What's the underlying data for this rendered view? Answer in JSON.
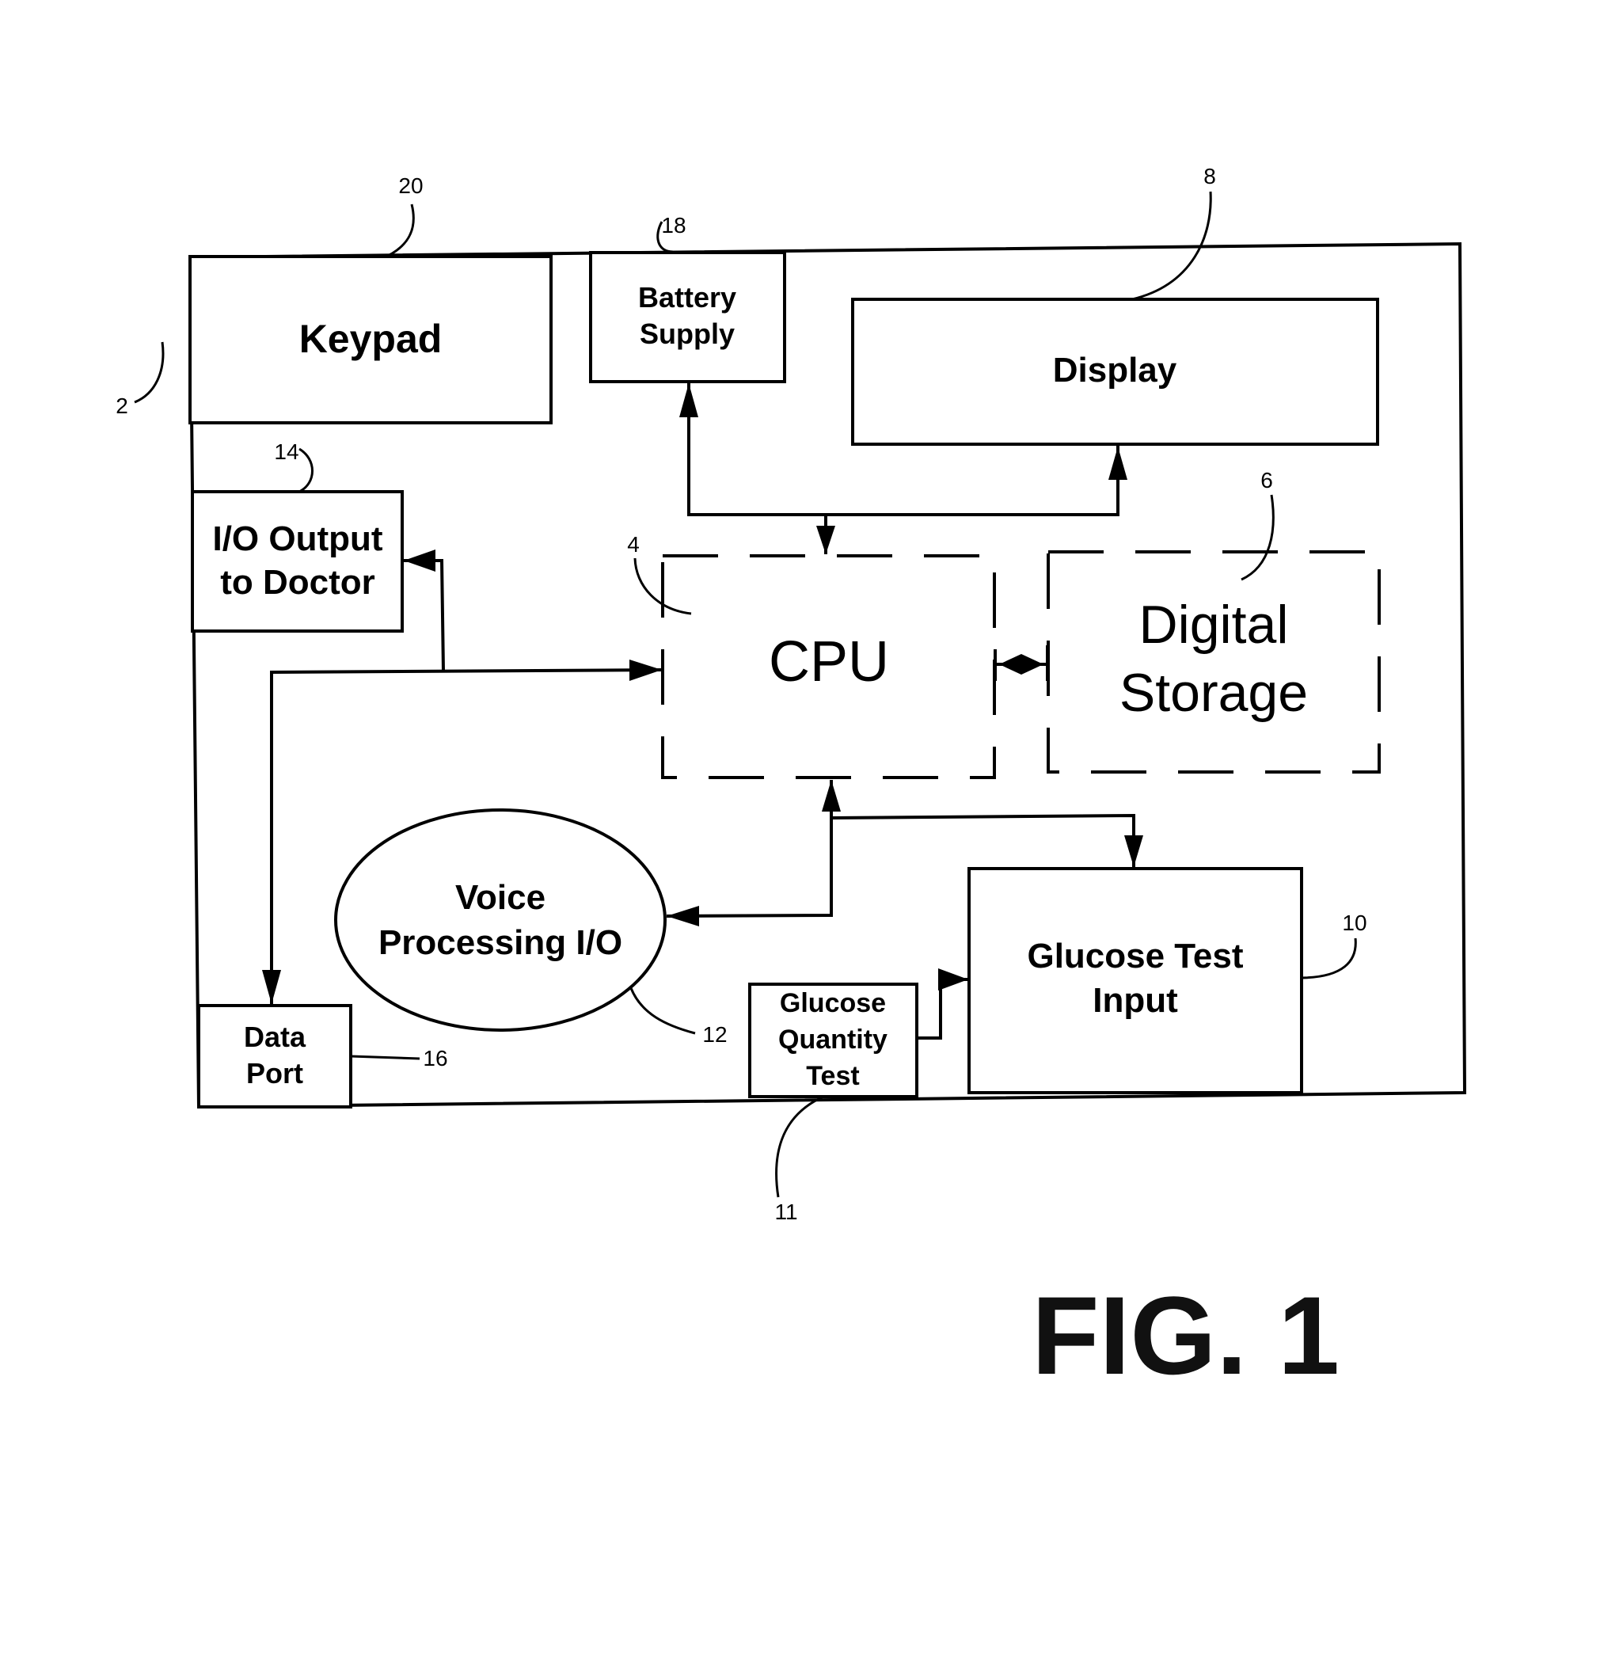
{
  "figure": {
    "title": "FIG. 1",
    "device_ref": "2"
  },
  "blocks": {
    "keypad": {
      "label": "Keypad",
      "ref": "20"
    },
    "battery": {
      "label_lines": [
        "Battery",
        "Supply"
      ],
      "ref": "18"
    },
    "display": {
      "label": "Display",
      "ref": "8"
    },
    "io_output": {
      "label_lines": [
        "I/O Output",
        "to Doctor"
      ],
      "ref": "14"
    },
    "cpu": {
      "label": "CPU",
      "ref": "4"
    },
    "storage": {
      "label_lines": [
        "Digital",
        "Storage"
      ],
      "ref": "6"
    },
    "voice": {
      "label_lines": [
        "Voice",
        "Processing I/O"
      ],
      "ref": "12"
    },
    "data_port": {
      "label_lines": [
        "Data",
        "Port"
      ],
      "ref": "16"
    },
    "glucose_qty": {
      "label_lines": [
        "Glucose",
        "Quantity",
        "Test"
      ],
      "ref": "11"
    },
    "glucose_input": {
      "label_lines": [
        "Glucose Test",
        "Input"
      ],
      "ref": "10"
    }
  }
}
